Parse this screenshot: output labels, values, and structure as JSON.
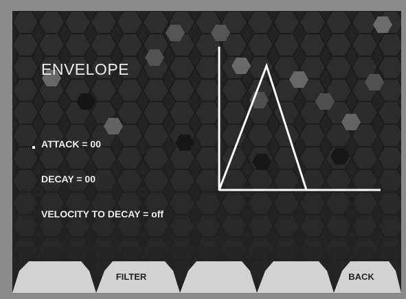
{
  "screen": {
    "title": "ENVELOPE",
    "selected_param_index": 0,
    "params": [
      {
        "label": "ATTACK = 00"
      },
      {
        "label": "DECAY = 00"
      },
      {
        "label": "VELOCITY TO DECAY = off"
      }
    ],
    "envelope_graph": {
      "attack": 0,
      "decay": 0,
      "shape": "triangle"
    }
  },
  "softkeys": [
    {
      "label": ""
    },
    {
      "label": "FILTER"
    },
    {
      "label": ""
    },
    {
      "label": ""
    },
    {
      "label": "BACK"
    }
  ],
  "colors": {
    "background": "#232323",
    "hex_pattern": "#3a3a3a",
    "text": "#f0f0f0",
    "softkey_fill": "#d2d2d2",
    "softkey_text": "#222222",
    "frame": "#8a8a8a"
  }
}
